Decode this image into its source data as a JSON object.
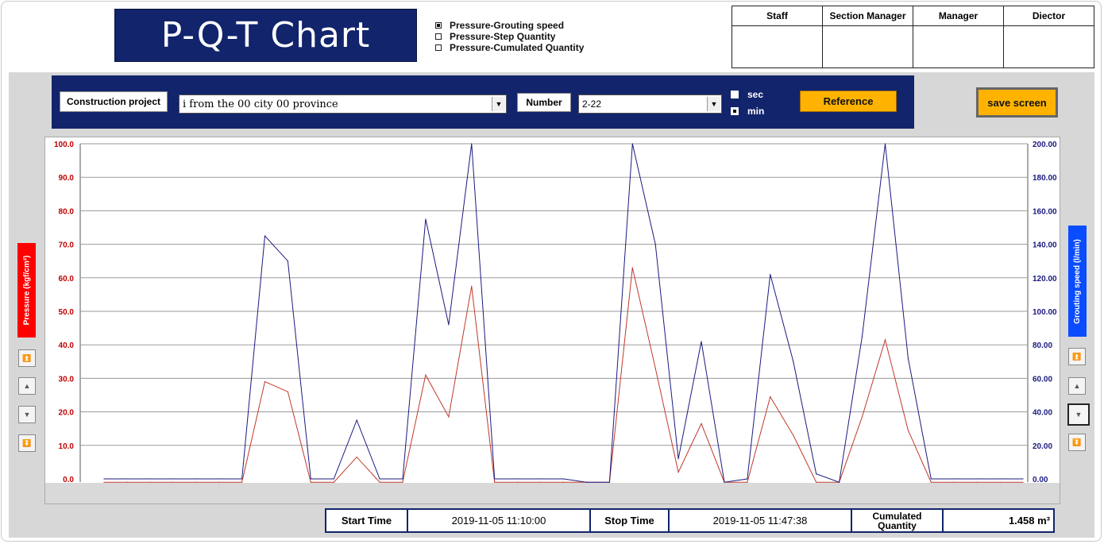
{
  "title": "P-Q-T Chart",
  "modes": [
    {
      "label": "Pressure-Grouting speed",
      "checked": true
    },
    {
      "label": "Pressure-Step Quantity",
      "checked": false
    },
    {
      "label": "Pressure-Cumulated Quantity",
      "checked": false
    }
  ],
  "approval": [
    "Staff",
    "Section Manager",
    "Manager",
    "Diector"
  ],
  "toolbar": {
    "project_label": "Construction project",
    "project_value": "i from the 00 city 00 province",
    "number_label": "Number",
    "number_value": "2-22",
    "units": [
      {
        "label": "sec",
        "checked": false
      },
      {
        "label": "min",
        "checked": true
      }
    ],
    "reference_label": "Reference",
    "save_label": "save screen"
  },
  "axis_labels": {
    "left": "Pressure (kgf/cm²)",
    "right": "Grouting speed (l/min)"
  },
  "colors": {
    "navy": "#12246b",
    "pressure": "#c0392b",
    "speed": "#1a1a80",
    "left_tag": "#ff0000",
    "right_tag": "#0a4cff",
    "button": "#ffb300"
  },
  "chart_data": {
    "type": "line",
    "x": [
      1,
      2,
      3,
      4,
      5,
      6,
      7,
      8,
      9,
      10,
      11,
      12,
      13,
      14,
      15,
      16,
      17,
      18,
      19,
      20,
      21,
      22,
      23,
      24,
      25,
      26,
      27,
      28,
      29,
      30,
      31,
      32,
      33,
      34,
      35,
      36,
      37,
      38,
      39,
      40,
      41
    ],
    "left_axis": {
      "min": 0,
      "max": 100,
      "ticks": [
        "0.0",
        "10.0",
        "20.0",
        "30.0",
        "40.0",
        "50.0",
        "60.0",
        "70.0",
        "80.0",
        "90.0",
        "100.0"
      ]
    },
    "right_axis": {
      "min": 0,
      "max": 200,
      "ticks": [
        "0.00",
        "20.00",
        "40.00",
        "60.00",
        "80.00",
        "100.00",
        "120.00",
        "140.00",
        "160.00",
        "180.00",
        "200.00"
      ]
    },
    "series": [
      {
        "axis": "left",
        "values": [
          -1,
          -1,
          -1,
          -1,
          -1,
          -1,
          -1,
          29,
          26,
          -1,
          -1,
          6.5,
          -1,
          -1,
          31,
          18.5,
          57.5,
          -1,
          -1,
          -1,
          -1,
          -1,
          -1,
          63,
          33,
          2,
          16.5,
          -1,
          -1,
          24.5,
          13,
          -1,
          -1,
          18.5,
          41.5,
          14.5,
          -1,
          -1,
          -1,
          -1,
          -1
        ]
      },
      {
        "axis": "right",
        "values": [
          0,
          0,
          0,
          0,
          0,
          0,
          0,
          145,
          130,
          0,
          0,
          35,
          0,
          0,
          155,
          92,
          200,
          0,
          0,
          0,
          0,
          -2,
          -2,
          200,
          140,
          12,
          82,
          -2,
          0,
          122,
          70,
          3,
          -2,
          85,
          200,
          72,
          0,
          0,
          0,
          0,
          0
        ]
      }
    ],
    "grid": "horizontal"
  },
  "footer": {
    "start_label": "Start Time",
    "start_value": "2019-11-05 11:10:00",
    "stop_label": "Stop Time",
    "stop_value": "2019-11-05 11:47:38",
    "cum_label": "Cumulated Quantity",
    "cum_value": "1.458 m³"
  }
}
